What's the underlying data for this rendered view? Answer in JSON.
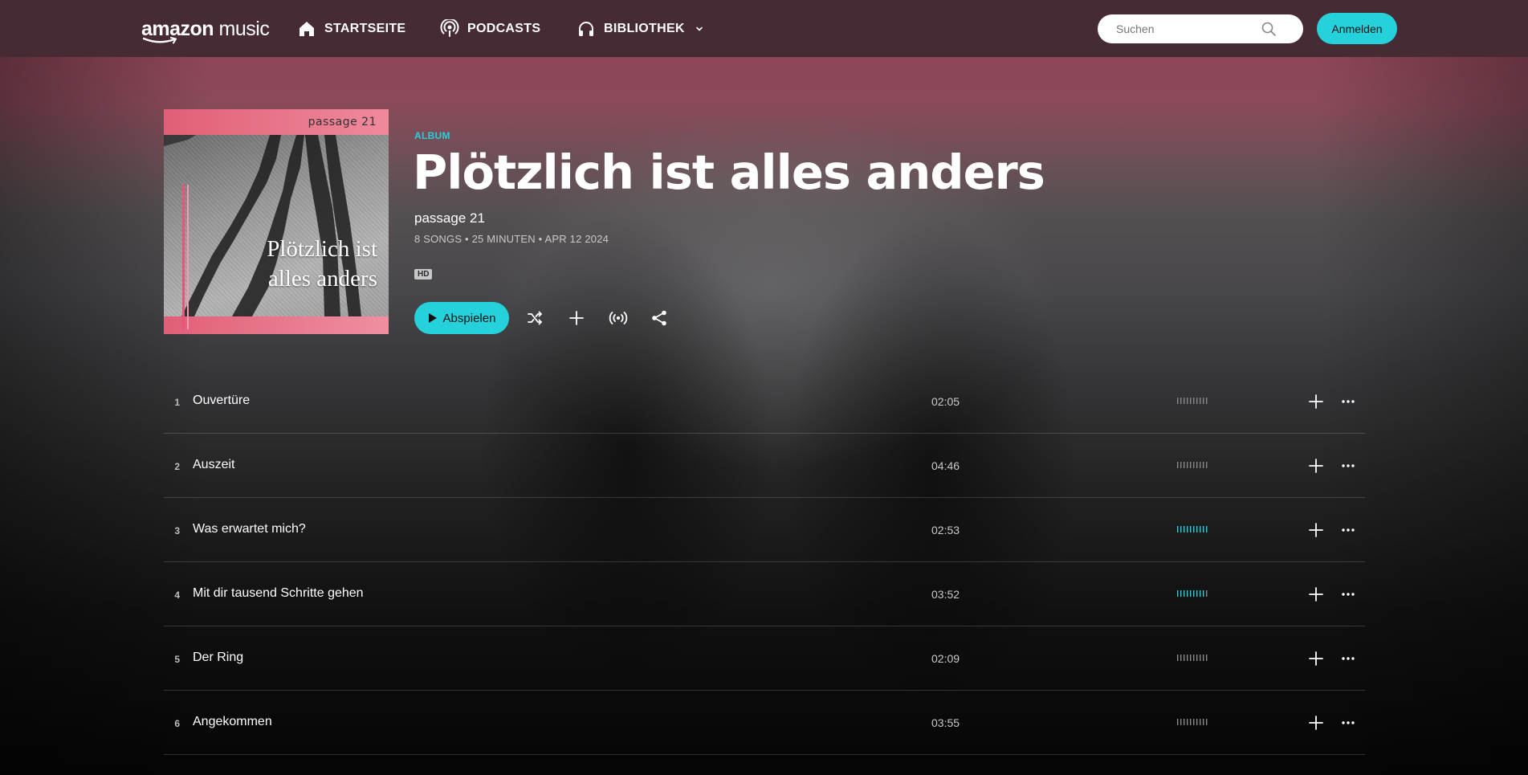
{
  "header": {
    "logo_bold": "amazon",
    "logo_light": " music",
    "nav": [
      {
        "label": "STARTSEITE",
        "icon": "home-icon"
      },
      {
        "label": "PODCASTS",
        "icon": "podcast-icon"
      },
      {
        "label": "BIBLIOTHEK",
        "icon": "headphones-icon"
      }
    ],
    "search_placeholder": "Suchen",
    "signin_label": "Anmelden"
  },
  "album": {
    "cover_label": "passage  21",
    "cover_title_line1": "Plötzlich ist",
    "cover_title_line2": "alles anders",
    "type": "ALBUM",
    "title": "Plötzlich ist alles anders",
    "artist": "passage 21",
    "meta": "8 SONGS • 25 MINUTEN • APR 12 2024",
    "badge": "HD",
    "play_label": "Abspielen",
    "accent_color": "#25d1da"
  },
  "tracks": [
    {
      "num": "1",
      "title": "Ouvertüre",
      "duration": "02:05",
      "popularity": 0
    },
    {
      "num": "2",
      "title": "Auszeit",
      "duration": "04:46",
      "popularity": 0
    },
    {
      "num": "3",
      "title": "Was erwartet mich?",
      "duration": "02:53",
      "popularity": 1.0
    },
    {
      "num": "4",
      "title": "Mit dir tausend Schritte gehen",
      "duration": "03:52",
      "popularity": 0.9
    },
    {
      "num": "5",
      "title": "Der Ring",
      "duration": "02:09",
      "popularity": 0
    },
    {
      "num": "6",
      "title": "Angekommen",
      "duration": "03:55",
      "popularity": 0
    }
  ]
}
